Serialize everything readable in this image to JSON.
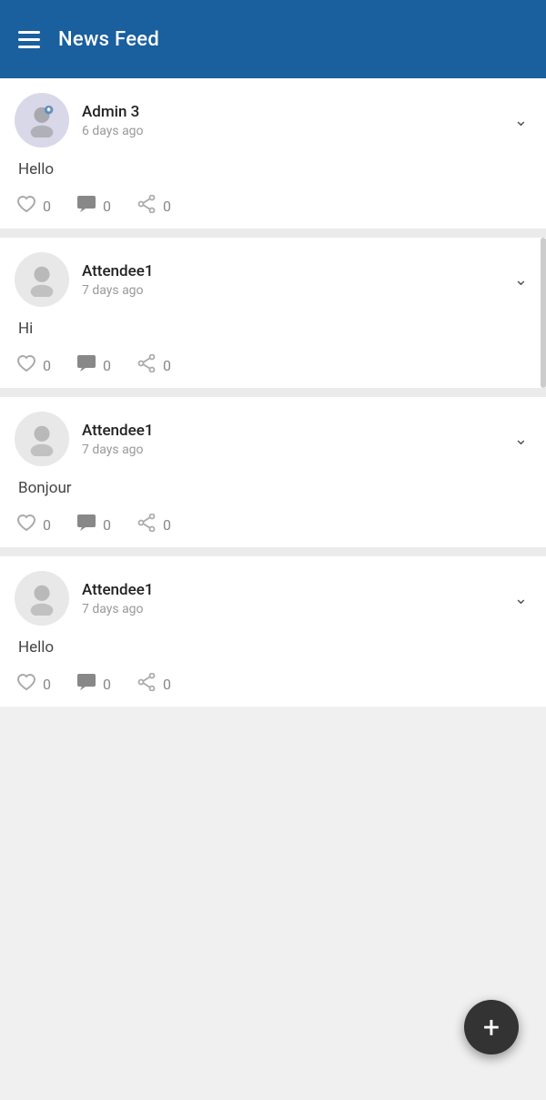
{
  "header": {
    "title": "News Feed",
    "menu_icon": "hamburger-icon"
  },
  "posts": [
    {
      "id": 1,
      "author": "Admin 3",
      "time": "6 days ago",
      "content": "Hello",
      "likes": 0,
      "comments": 0,
      "shares": 0,
      "avatar_type": "admin"
    },
    {
      "id": 2,
      "author": "Attendee1",
      "time": "7 days ago",
      "content": "Hi",
      "likes": 0,
      "comments": 0,
      "shares": 0,
      "avatar_type": "attendee"
    },
    {
      "id": 3,
      "author": "Attendee1",
      "time": "7 days ago",
      "content": "Bonjour",
      "likes": 0,
      "comments": 0,
      "shares": 0,
      "avatar_type": "attendee"
    },
    {
      "id": 4,
      "author": "Attendee1",
      "time": "7 days ago",
      "content": "Hello",
      "likes": 0,
      "comments": 0,
      "shares": 0,
      "avatar_type": "attendee"
    }
  ],
  "fab": {
    "label": "+"
  },
  "colors": {
    "header_bg": "#1a5f9e",
    "fab_bg": "#333333"
  }
}
